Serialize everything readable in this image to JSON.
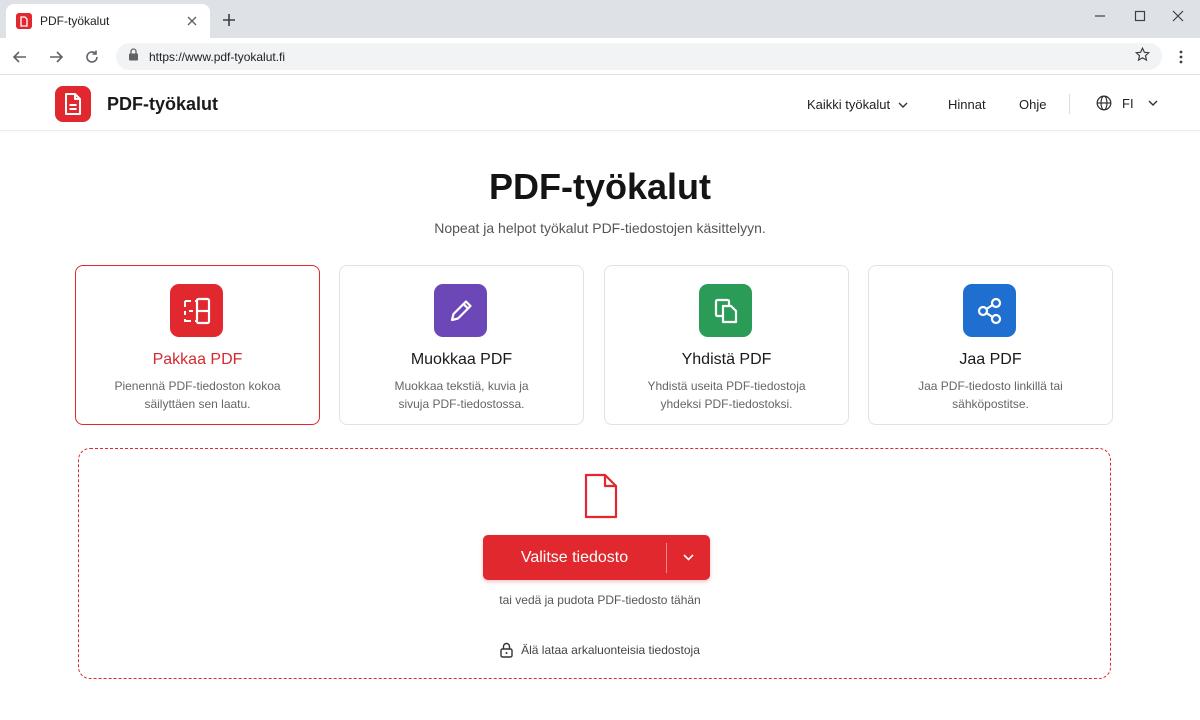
{
  "browser": {
    "tab_title": "PDF-työkalut",
    "url": "https://www.pdf-tyokalut.fi"
  },
  "header": {
    "logo_text": "PDF-työkalut",
    "nav": {
      "all_tools": "Kaikki työkalut",
      "pricing": "Hinnat",
      "help": "Ohje",
      "language": "FI"
    }
  },
  "hero": {
    "title": "PDF-työkalut",
    "subtitle": "Nopeat ja helpot työkalut PDF-tiedostojen käsittelyyn."
  },
  "cards": [
    {
      "title": "Pakkaa PDF",
      "desc_line1": "Pienennä PDF-tiedoston kokoa",
      "desc_line2": "säilyttäen sen laatu.",
      "color": "#e0282e",
      "icon": "compress-icon",
      "active": true
    },
    {
      "title": "Muokkaa PDF",
      "desc_line1": "Muokkaa tekstiä, kuvia ja",
      "desc_line2": "sivuja PDF-tiedostossa.",
      "color": "#6b47b8",
      "icon": "pencil-icon",
      "active": false
    },
    {
      "title": "Yhdistä PDF",
      "desc_line1": "Yhdistä useita PDF-tiedostoja",
      "desc_line2": "yhdeksi PDF-tiedostoksi.",
      "color": "#2a9c57",
      "icon": "merge-icon",
      "active": false
    },
    {
      "title": "Jaa PDF",
      "desc_line1": "Jaa PDF-tiedosto linkillä tai",
      "desc_line2": "sähköpostitse.",
      "color": "#1f6fd1",
      "icon": "share-icon",
      "active": false
    }
  ],
  "upload": {
    "button_label": "Valitse tiedosto",
    "hint": "tai vedä ja pudota PDF-tiedosto tähän",
    "privacy": "Älä lataa arkaluonteisia tiedostoja"
  },
  "colors": {
    "accent": "#e0282e"
  }
}
